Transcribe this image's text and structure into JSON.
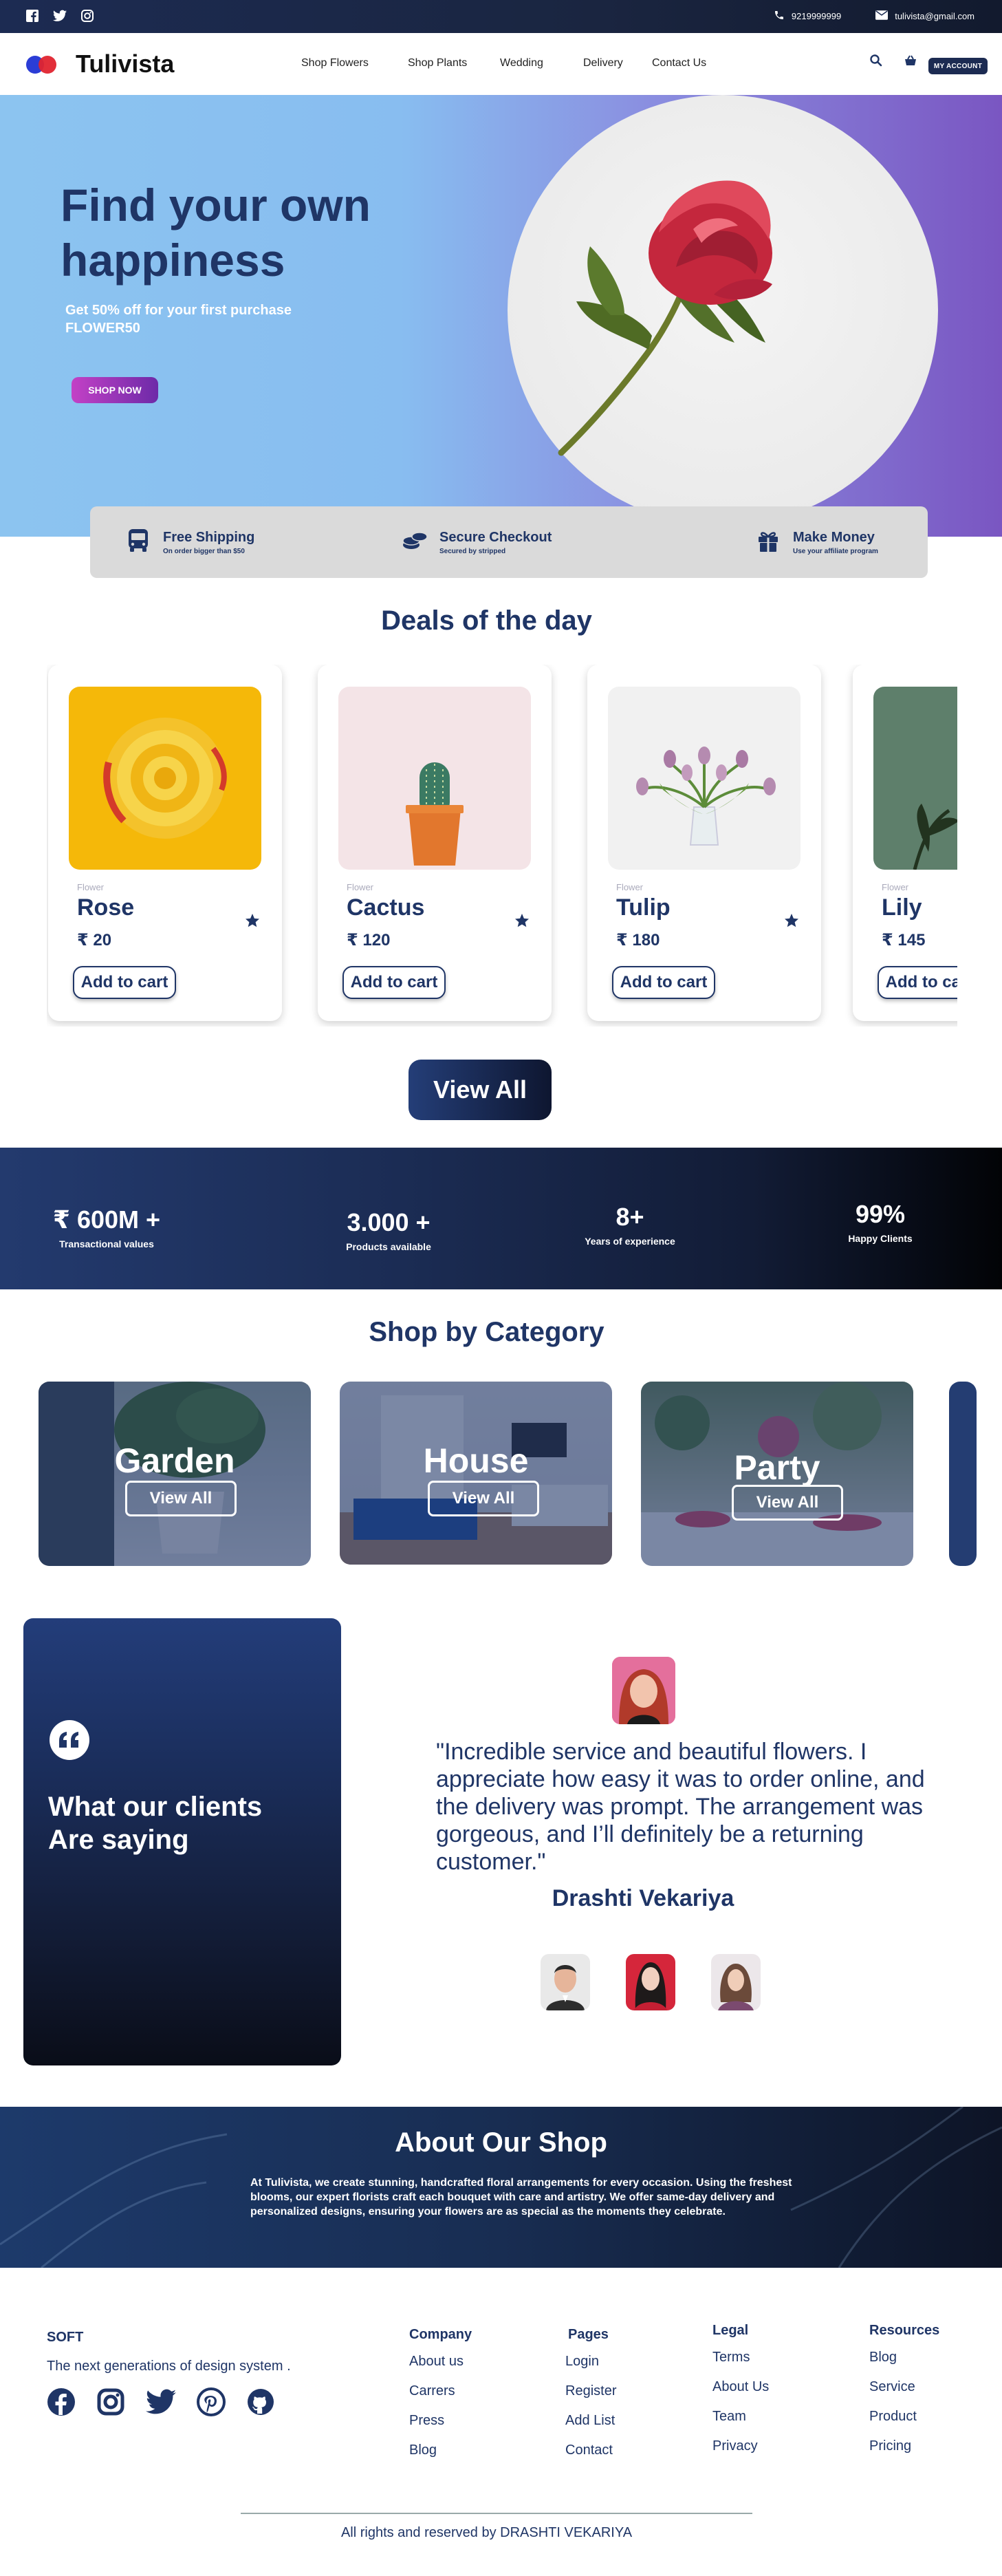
{
  "topbar": {
    "phone": "9219999999",
    "email": "tulivista@gmail.com",
    "social_icons": [
      "facebook-icon",
      "twitter-icon",
      "instagram-icon"
    ]
  },
  "nav": {
    "brand": "Tulivista",
    "menu": [
      "Shop Flowers",
      "Shop Plants",
      "Wedding",
      "Delivery",
      "Contact Us"
    ],
    "account_label": "MY ACCOUNT",
    "accent_colors": [
      "#2b3dd6",
      "#e0242f"
    ]
  },
  "hero": {
    "title": "Find your own happiness",
    "offer_line1": "Get 50% off for your first purchase",
    "offer_line2": "FLOWER50",
    "cta": "SHOP NOW"
  },
  "features": [
    {
      "title": "Free Shipping",
      "subtitle": "On order bigger than $50",
      "icon": "bus-icon"
    },
    {
      "title": "Secure Checkout",
      "subtitle": "Secured by stripped",
      "icon": "coins-icon"
    },
    {
      "title": "Make Money",
      "subtitle": "Use your affiliate program",
      "icon": "gift-icon"
    }
  ],
  "deals": {
    "title": "Deals of the day",
    "items": [
      {
        "category": "Flower",
        "name": "Rose",
        "price": "₹ 20",
        "button": "Add to cart"
      },
      {
        "category": "Flower",
        "name": "Cactus",
        "price": "₹ 120",
        "button": "Add to cart"
      },
      {
        "category": "Flower",
        "name": "Tulip",
        "price": "₹ 180",
        "button": "Add to cart"
      },
      {
        "category": "Flower",
        "name": "Lily",
        "price": "₹ 145",
        "button": "Add to cart"
      }
    ],
    "view_all": "View All"
  },
  "stats": [
    {
      "value": "₹ 600M +",
      "label": "Transactional   values"
    },
    {
      "value": "3.000 +",
      "label": "Products available"
    },
    {
      "value": "8+",
      "label": "Years of experience"
    },
    {
      "value": "99%",
      "label": "Happy Clients"
    }
  ],
  "categories": {
    "title": "Shop by Category",
    "items": [
      {
        "name": "Garden",
        "button": "View All"
      },
      {
        "name": "House",
        "button": "View All"
      },
      {
        "name": "Party",
        "button": "View All"
      }
    ]
  },
  "testimonials": {
    "heading_line1": "What our clients",
    "heading_line2": "Are saying",
    "quote": "\"Incredible service and beautiful flowers. I appreciate how easy it was to order online, and the delivery was prompt. The arrangement was gorgeous, and I’ll definitely be a returning customer.\"",
    "author": "Drashti Vekariya"
  },
  "about": {
    "title": "About Our Shop",
    "text": "At Tulivista, we create stunning, handcrafted floral arrangements for every occasion. Using the freshest blooms, our expert florists craft each bouquet with care and artistry. We offer same-day delivery and personalized designs, ensuring your flowers are as special as the moments they celebrate."
  },
  "footer": {
    "brand": "SOFT",
    "tagline": "The next generations of design system .",
    "social_icons": [
      "facebook-icon",
      "instagram-icon",
      "twitter-icon",
      "pinterest-icon",
      "github-icon"
    ],
    "columns": [
      {
        "heading": "Company",
        "items": [
          "About us",
          "Carrers",
          "Press",
          "Blog"
        ]
      },
      {
        "heading": "Pages",
        "items": [
          "Login",
          "Register",
          "Add List",
          "Contact"
        ]
      },
      {
        "heading": "Legal",
        "items": [
          "Terms",
          "About Us",
          "Team",
          "Privacy"
        ]
      },
      {
        "heading": "Resources",
        "items": [
          "Blog",
          "Service",
          "Product",
          "Pricing"
        ]
      }
    ],
    "copyright": "All rights and reserved by DRASHTI VEKARIYA"
  }
}
